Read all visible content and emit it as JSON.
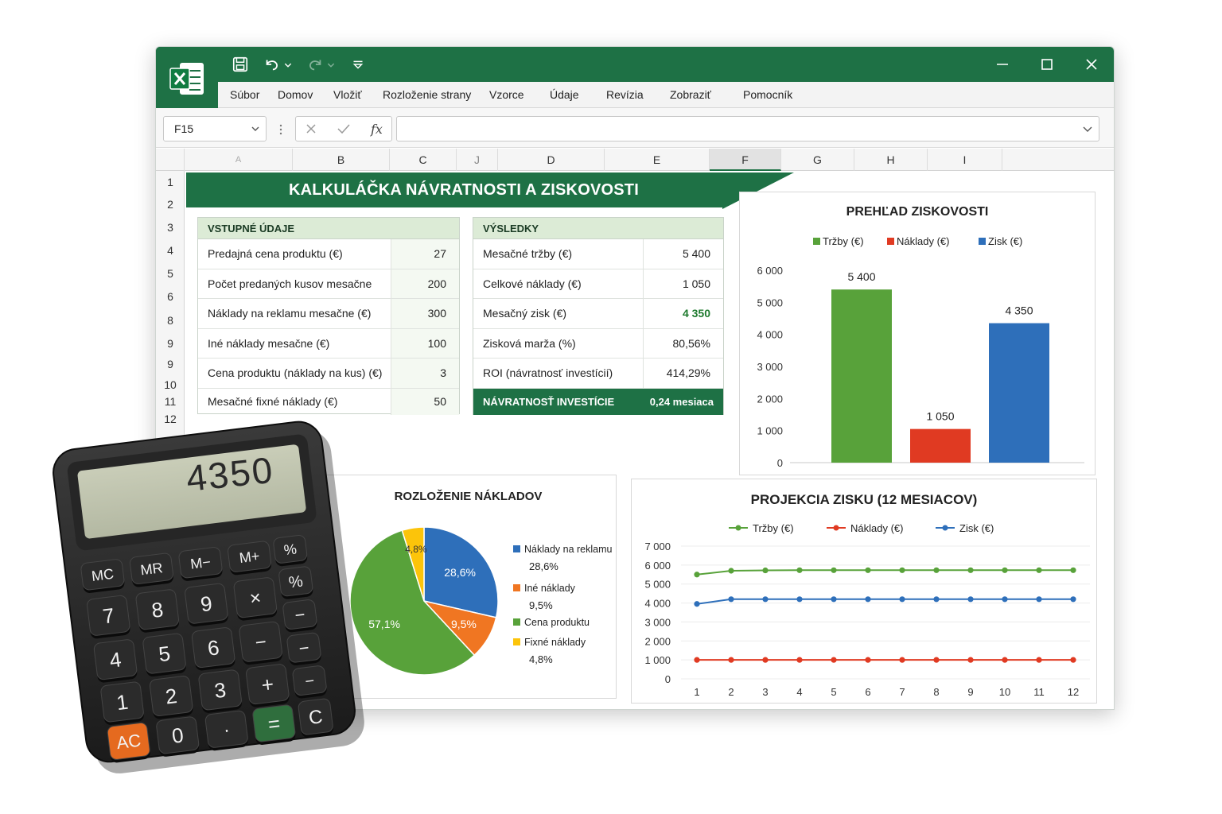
{
  "window": {
    "name_box": "F15",
    "fx_label": "fx",
    "menu": [
      "Súbor",
      "Domov",
      "Vložiť",
      "Rozloženie strany",
      "Vzorce",
      "Údaje",
      "Revízia",
      "Zobraziť",
      "Pomocník"
    ],
    "column_headers": [
      "A",
      "B",
      "C",
      "J",
      "D",
      "E",
      "F",
      "G",
      "H",
      "I"
    ],
    "selected_column": "F",
    "row_headers": [
      "1",
      "2",
      "3",
      "4",
      "5",
      "6",
      "8",
      "9",
      "9",
      "10",
      "11",
      "12"
    ]
  },
  "sheet": {
    "title": "KALKULÁČKA NÁVRATNOSTI A ZISKOVOSTI",
    "inputs": {
      "header": "VSTUPNÉ ÚDAJE",
      "rows": [
        {
          "label": "Predajná cena produktu (€)",
          "value": "27"
        },
        {
          "label": "Počet predaných kusov mesačne",
          "value": "200"
        },
        {
          "label": "Náklady na reklamu mesačne (€)",
          "value": "300"
        },
        {
          "label": "Iné náklady mesačne (€)",
          "value": "100"
        },
        {
          "label": "Cena produktu (náklady na kus) (€)",
          "value": "3"
        },
        {
          "label": "Mesačné fixné náklady (€)",
          "value": "50"
        }
      ]
    },
    "results": {
      "header": "VÝSLEDKY",
      "rows": [
        {
          "label": "Mesačné tržby (€)",
          "value": "5 400"
        },
        {
          "label": "Celkové náklady (€)",
          "value": "1 050"
        },
        {
          "label": "Mesačný zisk (€)",
          "value": "4 350"
        },
        {
          "label": "Zisková marža (%)",
          "value": "80,56%"
        },
        {
          "label": "ROI (návratnosť investícií)",
          "value": "414,29%"
        }
      ],
      "footer_label": "NÁVRATNOSŤ INVESTÍCIE",
      "footer_value": "0,24 mesiaca"
    }
  },
  "calculator": {
    "display": "4350",
    "keys": [
      "MC",
      "MR",
      "M−",
      "M+",
      "%",
      "%",
      "7",
      "8",
      "9",
      "×",
      "−",
      "4",
      "5",
      "6",
      "−",
      "−",
      "1",
      "2",
      "3",
      "+",
      "−",
      "AC",
      "0",
      "·",
      "=",
      "C"
    ]
  },
  "colors": {
    "excel_green": "#1e7145",
    "green": "#58a23a",
    "red": "#e03a22",
    "blue": "#2e6fba",
    "orange": "#f07622",
    "yellow": "#fcc40a"
  },
  "chart_data": [
    {
      "type": "bar",
      "title": "PREHĽAD ZISKOVOSTI",
      "categories": [
        "Tržby (€)",
        "Náklady (€)",
        "Zisk (€)"
      ],
      "values": [
        5400,
        1050,
        4350
      ],
      "value_labels": [
        "5 400",
        "1 050",
        "4 350"
      ],
      "legend": [
        "Tržby (€)",
        "Náklady (€)",
        "Zisk (€)"
      ],
      "legend_position": "top",
      "ylim": [
        0,
        6000
      ],
      "yticks": [
        "0",
        "1 000",
        "2 000",
        "3 000",
        "4 000",
        "5 000",
        "6 000"
      ]
    },
    {
      "type": "pie",
      "title": "ROZLOŽENIE NÁKLADOV",
      "labels": [
        "Náklady na reklamu",
        "Iné náklady",
        "Cena produktu",
        "Fixné náklady"
      ],
      "values": [
        28.6,
        9.5,
        57.1,
        4.8
      ],
      "value_labels": [
        "28,6%",
        "9,5%",
        "57,1%",
        "4,8%"
      ],
      "legend_position": "right"
    },
    {
      "type": "line",
      "title": "PROJEKCIA ZISKU (12 MESIACOV)",
      "x": [
        1,
        2,
        3,
        4,
        5,
        6,
        7,
        8,
        9,
        10,
        11,
        12
      ],
      "series": [
        {
          "name": "Tržby (€)",
          "values": [
            5500,
            5700,
            5720,
            5730,
            5730,
            5730,
            5730,
            5730,
            5730,
            5730,
            5730,
            5730
          ]
        },
        {
          "name": "Náklady (€)",
          "values": [
            1000,
            1000,
            1000,
            1000,
            1000,
            1000,
            1000,
            1000,
            1000,
            1000,
            1000,
            1000
          ]
        },
        {
          "name": "Zisk (€)",
          "values": [
            3950,
            4200,
            4200,
            4200,
            4200,
            4200,
            4200,
            4200,
            4200,
            4200,
            4200,
            4200
          ]
        }
      ],
      "legend_position": "top",
      "ylim": [
        0,
        7000
      ],
      "yticks": [
        "0",
        "1 000",
        "2 000",
        "3 000",
        "4 000",
        "5 000",
        "6 000",
        "7 000"
      ],
      "xticks": [
        "1",
        "2",
        "3",
        "4",
        "5",
        "6",
        "7",
        "8",
        "9",
        "10",
        "11",
        "12"
      ]
    }
  ]
}
